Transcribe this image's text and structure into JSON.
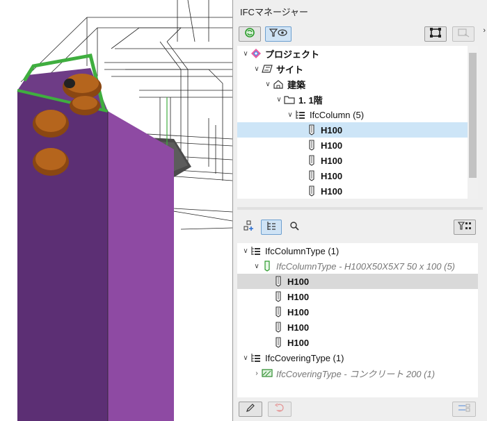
{
  "panel": {
    "title": "IFCマネージャー",
    "top_toolbar": {
      "refresh_icon": "refresh-icon",
      "filter_visibility_icon": "filter-eye-icon",
      "fit_selection_icon": "frame-select-icon",
      "disabled_action_icon": "frame-arrow-icon"
    },
    "collapse_arrow": "›"
  },
  "spatial_tree": {
    "rows": [
      {
        "label": "プロジェクト",
        "caret": "∨",
        "icon": "project-icon",
        "bold": true
      },
      {
        "label": "サイト",
        "caret": "∨",
        "icon": "site-icon",
        "bold": true
      },
      {
        "label": "建築",
        "caret": "∨",
        "icon": "building-icon",
        "bold": true
      },
      {
        "label": "1. 1階",
        "caret": "∨",
        "icon": "storey-folder-icon",
        "bold": true
      },
      {
        "label": "IfcColumn (5)",
        "caret": "∨",
        "icon": "element-group-icon",
        "bold": false
      },
      {
        "label": "H100",
        "caret": "",
        "icon": "column-icon",
        "bold": true,
        "selected": true
      },
      {
        "label": "H100",
        "caret": "",
        "icon": "column-icon",
        "bold": true
      },
      {
        "label": "H100",
        "caret": "",
        "icon": "column-icon",
        "bold": true
      },
      {
        "label": "H100",
        "caret": "",
        "icon": "column-icon",
        "bold": true
      },
      {
        "label": "H100",
        "caret": "",
        "icon": "column-icon",
        "bold": true
      }
    ]
  },
  "mid_toolbar": {
    "add_icon": "add-node-icon",
    "hierarchy_icon": "hierarchy-icon",
    "search_icon": "search-icon",
    "type_filter_icon": "filter-tree-icon"
  },
  "type_tree": {
    "rows": [
      {
        "label": "IfcColumnType (1)",
        "caret": "∨",
        "icon": "element-group-icon"
      },
      {
        "label": "IfcColumnType - H100X50X5X7 50 x 100 (5)",
        "caret": "∨",
        "icon": "column-type-icon",
        "italic": true
      },
      {
        "label": "H100",
        "icon": "column-icon",
        "bold": true,
        "selected": true
      },
      {
        "label": "H100",
        "icon": "column-icon",
        "bold": true
      },
      {
        "label": "H100",
        "icon": "column-icon",
        "bold": true
      },
      {
        "label": "H100",
        "icon": "column-icon",
        "bold": true
      },
      {
        "label": "H100",
        "icon": "column-icon",
        "bold": true
      },
      {
        "label": "IfcCoveringType (1)",
        "caret": "∨",
        "icon": "element-group-icon"
      },
      {
        "label": "IfcCoveringType - コンクリート 200 (1)",
        "caret": "›",
        "icon": "covering-type-icon",
        "italic": true
      }
    ]
  },
  "bottom_toolbar": {
    "edit_icon": "pencil-icon",
    "undo_icon": "undo-icon",
    "settings_icon": "transfer-settings-icon"
  },
  "colors": {
    "selection_blue": "#cde5f7",
    "selection_gray": "#d9d9d9",
    "column_purple": "#8e4aa3",
    "bolt_brown": "#b5651d",
    "outline_green": "#3fae3f"
  }
}
